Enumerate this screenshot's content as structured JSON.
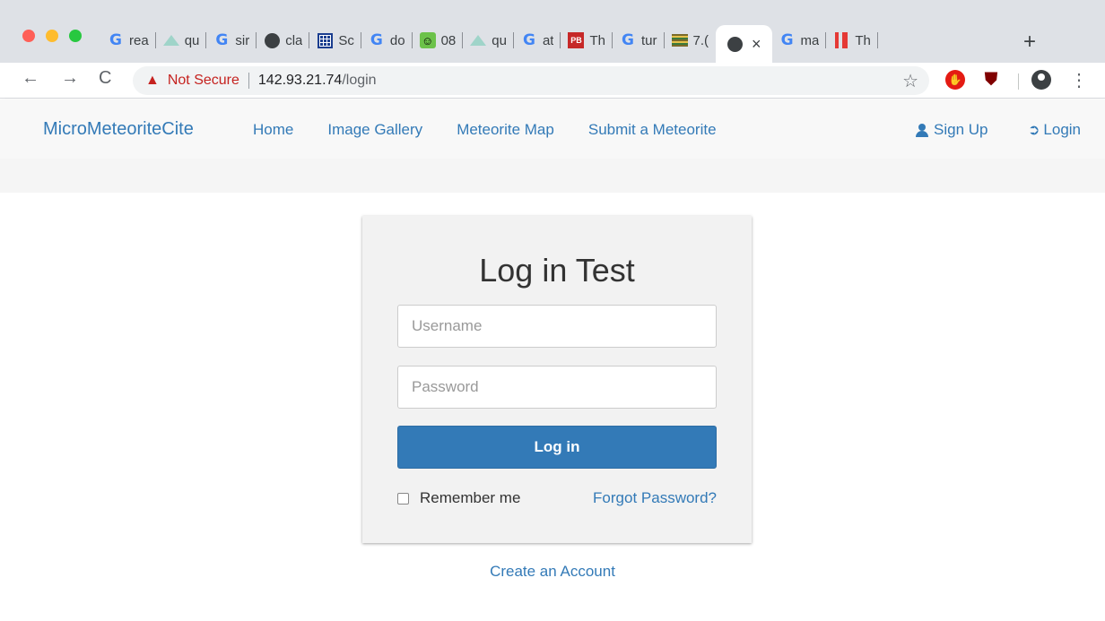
{
  "browser": {
    "tabs": [
      {
        "icon": "google-icon",
        "title": "rea"
      },
      {
        "icon": "triangle-icon",
        "title": "qu"
      },
      {
        "icon": "google-icon",
        "title": "sir"
      },
      {
        "icon": "globe-icon",
        "title": "cla"
      },
      {
        "icon": "grid-icon",
        "title": "Sc"
      },
      {
        "icon": "google-icon",
        "title": "do"
      },
      {
        "icon": "smiley-icon",
        "title": "08"
      },
      {
        "icon": "triangle-icon",
        "title": "qu"
      },
      {
        "icon": "google-icon",
        "title": "at"
      },
      {
        "icon": "pb-icon",
        "title": "Th",
        "badge": "PB"
      },
      {
        "icon": "google-icon",
        "title": "tur"
      },
      {
        "icon": "books-icon",
        "title": "7.("
      },
      {
        "icon": "globe-icon",
        "title": "",
        "active": true
      },
      {
        "icon": "google-icon",
        "title": "ma"
      },
      {
        "icon": "bars-icon",
        "title": "Th"
      }
    ],
    "google_glyph": "G",
    "close_glyph": "×",
    "new_tab_glyph": "+",
    "smiley_glyph": "☺",
    "back_glyph": "←",
    "forward_glyph": "→",
    "reload_glyph": "C",
    "warning_glyph": "▲",
    "security_label": "Not Secure",
    "url_host": "142.93.21.74",
    "url_path": "/login",
    "star_glyph": "☆",
    "menu_glyph": "⋮",
    "shield_glyph": "⛊",
    "ublock_label": "ub"
  },
  "navbar": {
    "brand": "MicroMeteoriteCite",
    "links": [
      "Home",
      "Image Gallery",
      "Meteorite Map",
      "Submit a Meteorite"
    ],
    "signup": "Sign Up",
    "login": "Login",
    "login_glyph": "➲"
  },
  "login_form": {
    "title": "Log in Test",
    "username_placeholder": "Username",
    "password_placeholder": "Password",
    "submit_label": "Log in",
    "remember_label": "Remember me",
    "remember_checked": false,
    "forgot_label": "Forgot Password?"
  },
  "create_account": "Create an Account",
  "colors": {
    "link": "#337ab7",
    "button": "#337ab7",
    "warning": "#c5221f"
  }
}
